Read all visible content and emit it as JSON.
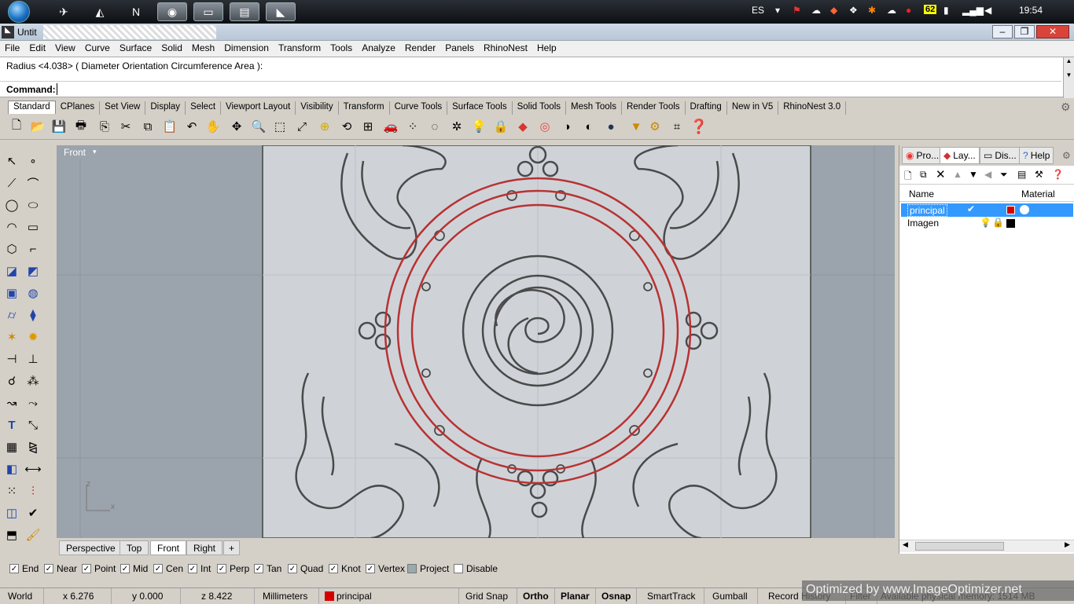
{
  "taskbar": {
    "language": "ES",
    "clock": "19:54",
    "badge_count": "62"
  },
  "window": {
    "title": "Untit"
  },
  "menu": [
    "File",
    "Edit",
    "View",
    "Curve",
    "Surface",
    "Solid",
    "Mesh",
    "Dimension",
    "Transform",
    "Tools",
    "Analyze",
    "Render",
    "Panels",
    "RhinoNest",
    "Help"
  ],
  "command": {
    "history": "Radius <4.038> ( Diameter  Orientation  Circumference  Area ):",
    "prompt": "Command:"
  },
  "toolbar_tabs": [
    "Standard",
    "CPlanes",
    "Set View",
    "Display",
    "Select",
    "Viewport Layout",
    "Visibility",
    "Transform",
    "Curve Tools",
    "Surface Tools",
    "Solid Tools",
    "Mesh Tools",
    "Render Tools",
    "Drafting",
    "New in V5",
    "RhinoNest 3.0"
  ],
  "viewport": {
    "title": "Front",
    "axis_z": "z",
    "axis_x": "x"
  },
  "viewport_tabs": [
    "Perspective",
    "Top",
    "Front",
    "Right"
  ],
  "osnaps": [
    {
      "label": "End",
      "checked": true
    },
    {
      "label": "Near",
      "checked": true
    },
    {
      "label": "Point",
      "checked": true
    },
    {
      "label": "Mid",
      "checked": true
    },
    {
      "label": "Cen",
      "checked": true
    },
    {
      "label": "Int",
      "checked": true
    },
    {
      "label": "Perp",
      "checked": true
    },
    {
      "label": "Tan",
      "checked": true
    },
    {
      "label": "Quad",
      "checked": true
    },
    {
      "label": "Knot",
      "checked": true
    },
    {
      "label": "Vertex",
      "checked": true
    },
    {
      "label": "Project",
      "checked": false
    },
    {
      "label": "Disable",
      "checked": false
    }
  ],
  "status": {
    "cplane": "World",
    "x": "x 6.276",
    "y": "y 0.000",
    "z": "z 8.422",
    "units": "Millimeters",
    "layer": "principal",
    "grid_snap": "Grid Snap",
    "ortho": "Ortho",
    "planar": "Planar",
    "osnap": "Osnap",
    "smarttrack": "SmartTrack",
    "gumball": "Gumball",
    "record_history": "Record History",
    "filter": "Filter",
    "memory": "Available physical memory: 1514 MB",
    "watermark": "Optimized by www.ImageOptimizer.net"
  },
  "panel": {
    "tabs": [
      "Pro...",
      "Lay...",
      "Dis...",
      "Help"
    ],
    "col_name": "Name",
    "col_material": "Material",
    "layers": [
      {
        "name": "principal",
        "current": true,
        "color": "#d40000"
      },
      {
        "name": "Imagen",
        "current": false,
        "color": "#000000"
      }
    ]
  },
  "colors": {
    "curve_red": "#b83232",
    "curve_gray": "#4a4a4a",
    "selection": "#3399ff"
  }
}
